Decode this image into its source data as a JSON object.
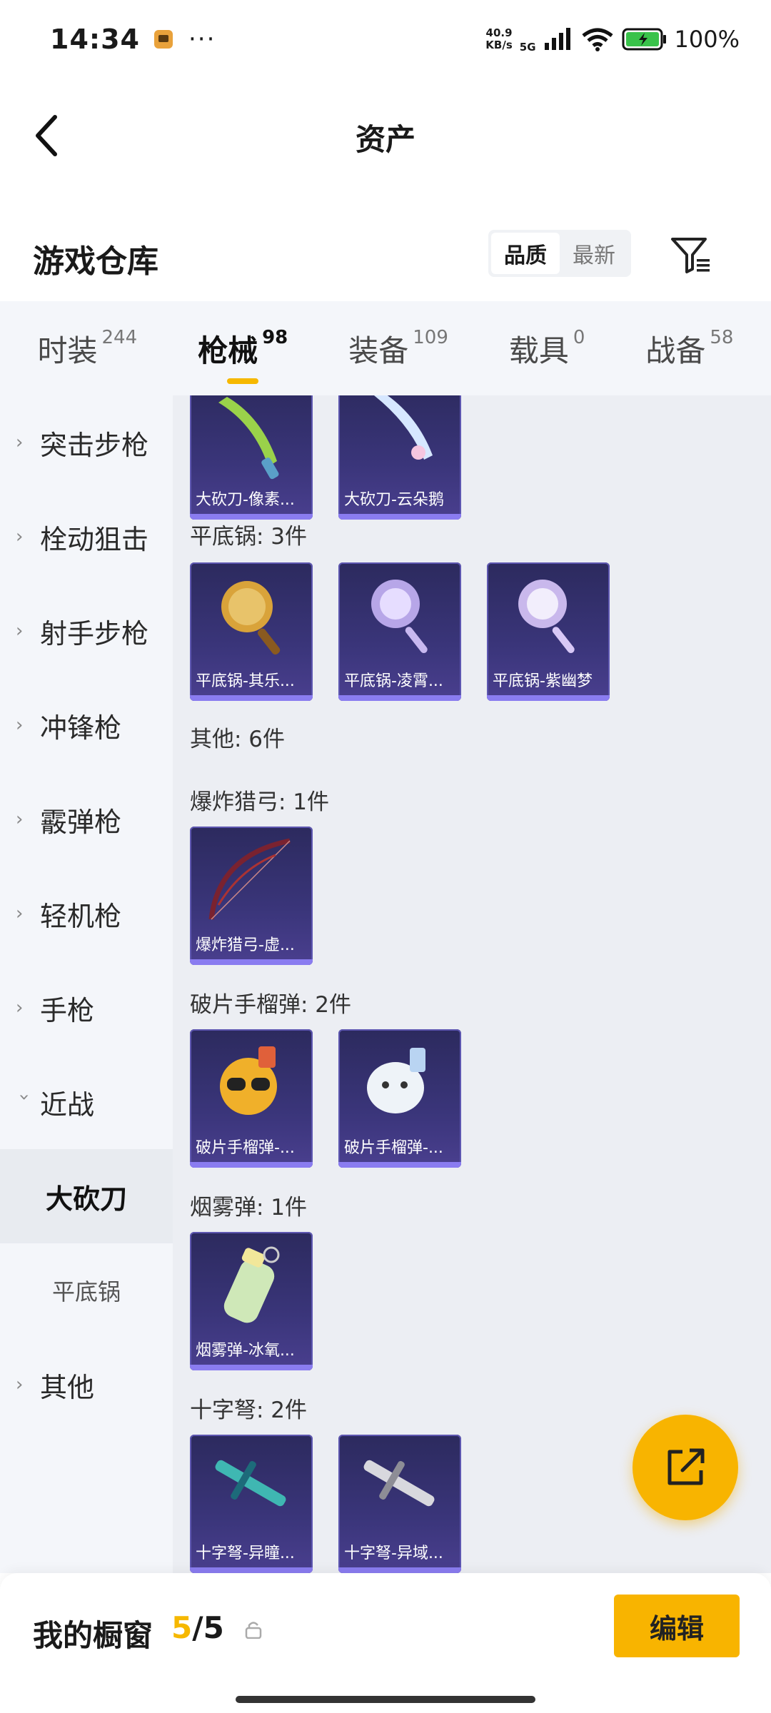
{
  "status_bar": {
    "time": "14:34",
    "dots": "···",
    "speed_top": "40.9",
    "speed_bottom": "KB/s",
    "network": "5G",
    "battery": "100%"
  },
  "header": {
    "title": "资产"
  },
  "warehouse": {
    "title": "游戏仓库",
    "sort_options": [
      "品质",
      "最新"
    ],
    "sort_active": "品质"
  },
  "tabs": [
    {
      "label": "时装",
      "count": "244"
    },
    {
      "label": "枪械",
      "count": "98",
      "active": true
    },
    {
      "label": "装备",
      "count": "109"
    },
    {
      "label": "载具",
      "count": "0"
    },
    {
      "label": "战备",
      "count": "58"
    }
  ],
  "sidebar": {
    "items": [
      {
        "label": "突击步枪"
      },
      {
        "label": "栓动狙击"
      },
      {
        "label": "射手步枪"
      },
      {
        "label": "冲锋枪"
      },
      {
        "label": "霰弹枪"
      },
      {
        "label": "轻机枪"
      },
      {
        "label": "手枪"
      },
      {
        "label": "近战",
        "expanded": true
      }
    ],
    "sub_items": [
      {
        "label": "大砍刀",
        "active": true
      },
      {
        "label": "平底锅"
      }
    ],
    "last_item": {
      "label": "其他"
    }
  },
  "content": {
    "top_items": [
      {
        "name": "大砍刀-像素..."
      },
      {
        "name": "大砍刀-云朵鹅"
      }
    ],
    "groups": {
      "pan": {
        "label": "平底锅: 3件",
        "items": [
          {
            "name": "平底锅-其乐..."
          },
          {
            "name": "平底锅-凌霄..."
          },
          {
            "name": "平底锅-紫幽梦"
          }
        ]
      },
      "other": {
        "label": "其他: 6件"
      },
      "bow": {
        "label": "爆炸猎弓: 1件",
        "items": [
          {
            "name": "爆炸猎弓-虚..."
          }
        ]
      },
      "frag": {
        "label": "破片手榴弹: 2件",
        "items": [
          {
            "name": "破片手榴弹-..."
          },
          {
            "name": "破片手榴弹-..."
          }
        ]
      },
      "smoke": {
        "label": "烟雾弹: 1件",
        "items": [
          {
            "name": "烟雾弹-冰氧..."
          }
        ]
      },
      "crossbow": {
        "label": "十字弩: 2件",
        "items": [
          {
            "name": "十字弩-异瞳..."
          },
          {
            "name": "十字弩-异域..."
          }
        ]
      }
    }
  },
  "bottom_bar": {
    "label": "我的橱窗",
    "current": "5",
    "total": "/5",
    "edit_label": "编辑"
  },
  "colors": {
    "accent": "#f8b400",
    "card_bg": "#3a357a",
    "card_strip": "#8a7cf0"
  }
}
